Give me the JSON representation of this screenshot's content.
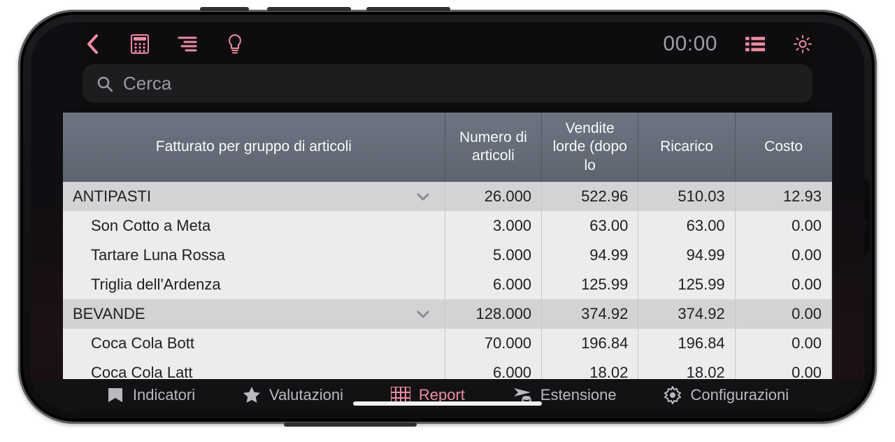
{
  "accent": "#f08aa0",
  "toolbar": {
    "timer": "00:00"
  },
  "search": {
    "placeholder": "Cerca"
  },
  "table": {
    "headers": {
      "group": "Fatturato per gruppo di articoli",
      "qty": "Numero di articoli",
      "gross": "Vendite lorde (dopo lo",
      "markup": "Ricarico",
      "cost": "Costo"
    },
    "rows": [
      {
        "type": "group",
        "label": "ANTIPASTI",
        "qty": "26.000",
        "gross": "522.96",
        "markup": "510.03",
        "cost": "12.93"
      },
      {
        "type": "item",
        "label": "Son Cotto a Meta",
        "qty": "3.000",
        "gross": "63.00",
        "markup": "63.00",
        "cost": "0.00"
      },
      {
        "type": "item",
        "label": "Tartare Luna Rossa",
        "qty": "5.000",
        "gross": "94.99",
        "markup": "94.99",
        "cost": "0.00"
      },
      {
        "type": "item",
        "label": "Triglia dell'Ardenza",
        "qty": "6.000",
        "gross": "125.99",
        "markup": "125.99",
        "cost": "0.00"
      },
      {
        "type": "group",
        "label": "BEVANDE",
        "qty": "128.000",
        "gross": "374.92",
        "markup": "374.92",
        "cost": "0.00"
      },
      {
        "type": "item",
        "label": "Coca Cola Bott",
        "qty": "70.000",
        "gross": "196.84",
        "markup": "196.84",
        "cost": "0.00"
      },
      {
        "type": "item",
        "label": "Coca Cola Latt",
        "qty": "6.000",
        "gross": "18.02",
        "markup": "18.02",
        "cost": "0.00"
      }
    ]
  },
  "tabs": {
    "indicators": "Indicatori",
    "ratings": "Valutazioni",
    "report": "Report",
    "extension": "Estensione",
    "settings": "Configurazioni"
  }
}
